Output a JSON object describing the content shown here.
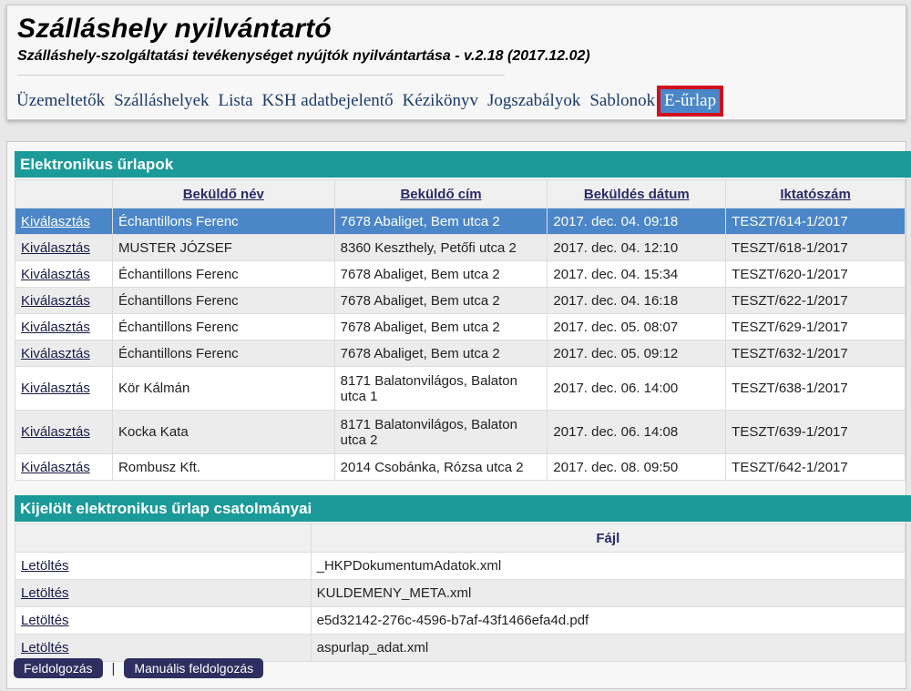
{
  "header": {
    "title": "Szálláshely nyilvántartó",
    "subtitle": "Szálláshely-szolgáltatási tevékenységet nyújtók nyilvántartása - v.2.18 (2017.12.02)"
  },
  "nav": [
    {
      "label": "Üzemeltetők",
      "active": false
    },
    {
      "label": "Szálláshelyek",
      "active": false
    },
    {
      "label": "Lista",
      "active": false
    },
    {
      "label": "KSH adatbejelentő",
      "active": false
    },
    {
      "label": "Kézikönyv",
      "active": false
    },
    {
      "label": "Jogszabályok",
      "active": false
    },
    {
      "label": "Sablonok",
      "active": false
    },
    {
      "label": "E-űrlap",
      "active": true
    }
  ],
  "forms": {
    "title": "Elektronikus űrlapok",
    "columns": [
      "",
      "Beküldő név",
      "Beküldő cím",
      "Beküldés dátum",
      "Iktatószám"
    ],
    "action_label": "Kiválasztás",
    "rows": [
      {
        "name": "Échantillons Ferenc",
        "address": "7678 Abaliget, Bem utca 2",
        "date": "2017. dec. 04. 09:18",
        "id": "TESZT/614-1/2017",
        "selected": true
      },
      {
        "name": "MUSTER JÓZSEF",
        "address": "8360 Keszthely, Petőfi utca 2",
        "date": "2017. dec. 04. 12:10",
        "id": "TESZT/618-1/2017"
      },
      {
        "name": "Échantillons Ferenc",
        "address": "7678 Abaliget, Bem utca 2",
        "date": "2017. dec. 04. 15:34",
        "id": "TESZT/620-1/2017"
      },
      {
        "name": "Échantillons Ferenc",
        "address": "7678 Abaliget, Bem utca 2",
        "date": "2017. dec. 04. 16:18",
        "id": "TESZT/622-1/2017"
      },
      {
        "name": "Échantillons Ferenc",
        "address": "7678 Abaliget, Bem utca 2",
        "date": "2017. dec. 05. 08:07",
        "id": "TESZT/629-1/2017"
      },
      {
        "name": "Échantillons Ferenc",
        "address": "7678 Abaliget, Bem utca 2",
        "date": "2017. dec. 05. 09:12",
        "id": "TESZT/632-1/2017"
      },
      {
        "name": "Kör Kálmán",
        "address": "8171 Balatonvilágos, Balaton utca 1",
        "date": "2017. dec. 06. 14:00",
        "id": "TESZT/638-1/2017"
      },
      {
        "name": "Kocka Kata",
        "address": "8171 Balatonvilágos, Balaton utca 2",
        "date": "2017. dec. 06. 14:08",
        "id": "TESZT/639-1/2017"
      },
      {
        "name": "Rombusz Kft.",
        "address": "2014 Csobánka, Rózsa utca 2",
        "date": "2017. dec. 08. 09:50",
        "id": "TESZT/642-1/2017"
      }
    ]
  },
  "attachments": {
    "title": "Kijelölt elektronikus űrlap csatolmányai",
    "column": "Fájl",
    "action_label": "Letöltés",
    "files": [
      "_HKPDokumentumAdatok.xml",
      "KULDEMENY_META.xml",
      "e5d32142-276c-4596-b7af-43f1466efa4d.pdf",
      "aspurlap_adat.xml"
    ]
  },
  "buttons": {
    "process": "Feldolgozás",
    "separator": "|",
    "manual": "Manuális feldolgozás"
  }
}
